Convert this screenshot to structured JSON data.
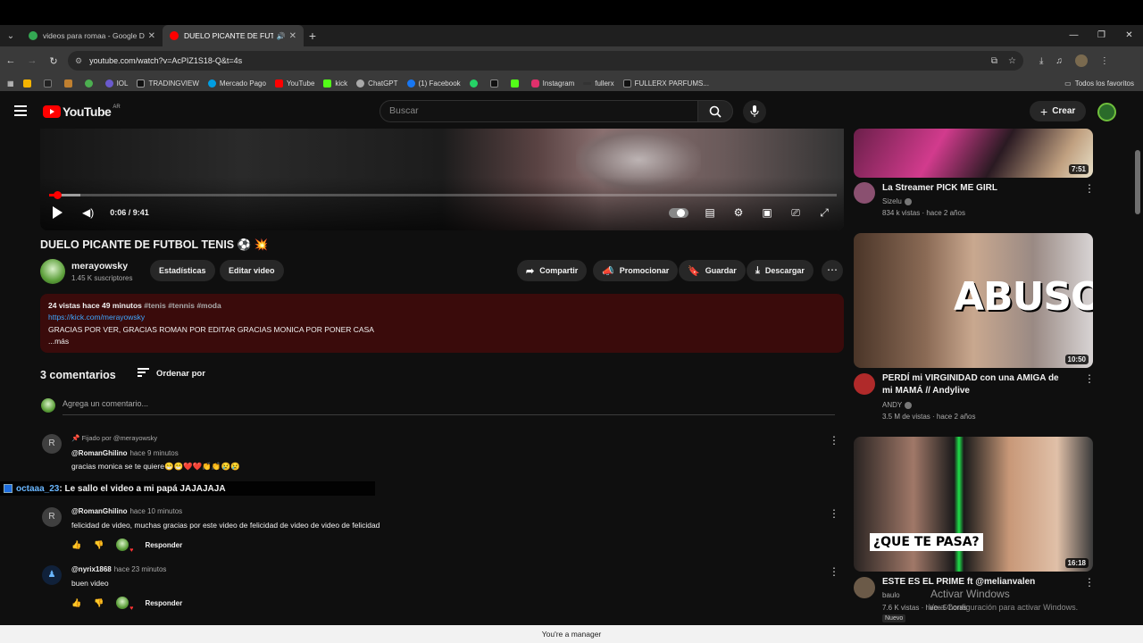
{
  "browser": {
    "tabs": [
      {
        "title": "videos para romaa - Google Dr",
        "favicon_color": "#34a853"
      },
      {
        "title": "DUELO PICANTE DE FUTBOL",
        "favicon_color": "#ff0000"
      }
    ],
    "url": "youtube.com/watch?v=AcPIZ1S18-Q&t=4s",
    "bookmarks": [
      {
        "label": "",
        "color": "#f5b400"
      },
      {
        "label": "",
        "color": "#222222"
      },
      {
        "label": "",
        "color": "#c08030"
      },
      {
        "label": "",
        "color": "#4caf50"
      },
      {
        "label": "IOL",
        "color": "#6a5acd"
      },
      {
        "label": "TRADINGVIEW",
        "color": "#111111"
      },
      {
        "label": "Mercado Pago",
        "color": "#009ee3"
      },
      {
        "label": "YouTube",
        "color": "#ff0000"
      },
      {
        "label": "kick",
        "color": "#53fc18"
      },
      {
        "label": "ChatGPT",
        "color": "#aaaaaa"
      },
      {
        "label": "(1) Facebook",
        "color": "#1877f2"
      },
      {
        "label": "",
        "color": "#25d366"
      },
      {
        "label": "",
        "color": "#111111"
      },
      {
        "label": "",
        "color": "#53fc18"
      },
      {
        "label": "Instagram",
        "color": "#e1306c"
      },
      {
        "label": "fullerx",
        "color": "#333333"
      },
      {
        "label": "FULLERX PARFUMS...",
        "color": "#111111"
      }
    ],
    "bookmarks_right": "Todos los favoritos"
  },
  "youtube": {
    "logo": "YouTube",
    "country": "AR",
    "search_placeholder": "Buscar",
    "create_label": "Crear"
  },
  "player": {
    "time": "0:06 / 9:41",
    "progress_fraction": 0.0103,
    "buffered_fraction": 0.04
  },
  "video": {
    "title": "DUELO PICANTE DE FUTBOL TENIS ⚽ 💥",
    "channel": "merayowsky",
    "subscribers": "1.45 K suscriptores",
    "buttons": {
      "stats": "Estadísticas",
      "edit": "Editar video",
      "share": "Compartir",
      "promote": "Promocionar",
      "save": "Guardar",
      "download": "Descargar"
    },
    "desc_meta": "24 vistas  hace 49 minutos",
    "desc_tags": "#tenis #tennis #moda",
    "desc_link": "https://kick.com/merayowsky",
    "desc_text": "GRACIAS POR VER, GRACIAS ROMAN POR EDITAR GRACIAS MONICA POR PONER CASA",
    "desc_more": "...más"
  },
  "comments": {
    "count_label": "3 comentarios",
    "sort_label": "Ordenar por",
    "add_placeholder": "Agrega un comentario...",
    "reply_label": "Responder",
    "items": [
      {
        "initial": "R",
        "pinned": "Fijado por @merayowsky",
        "author": "@RomanGhilino",
        "when": "hace 9 minutos",
        "text": "gracias monica se te quiere😁😁❤️❤️👏👏😢😢"
      },
      {
        "initial": "R",
        "author": "@RomanGhilino",
        "when": "hace 10 minutos",
        "text": "felicidad de video,  muchas gracias por este video de felicidad de video de video de felicidad"
      },
      {
        "initial": "",
        "author": "@nyrix1868",
        "when": "hace 23 minutos",
        "text": "buen video"
      }
    ]
  },
  "overlay_chat": {
    "user": "octaaa_23",
    "message": ": Le sallo el video a mi papá JAJAJAJA"
  },
  "sidebar": [
    {
      "title": "La Streamer PICK ME GIRL",
      "channel": "Sizelu",
      "meta": "834 k vistas · hace 2 años",
      "duration": "7:51"
    },
    {
      "title": "PERDÍ mi VIRGINIDAD con una AMIGA de mi MAMÁ // Andylive",
      "channel": "ANDY",
      "meta": "3.5 M de vistas · hace 2 años",
      "duration": "10:50",
      "thumb_text": "ABUSO?"
    },
    {
      "title": "ESTE ES EL PRIME ft @melianvalen",
      "channel": "baulo",
      "meta": "7.6 K vistas · hace 5 horas",
      "duration": "16:18",
      "thumb_text": "¿QUE TE PASA?",
      "badge": "Nuevo"
    }
  ],
  "windows_watermark": {
    "line1": "Activar Windows",
    "line2": "Ve a Configuración para activar Windows."
  },
  "bottom_bar": "You're a manager"
}
